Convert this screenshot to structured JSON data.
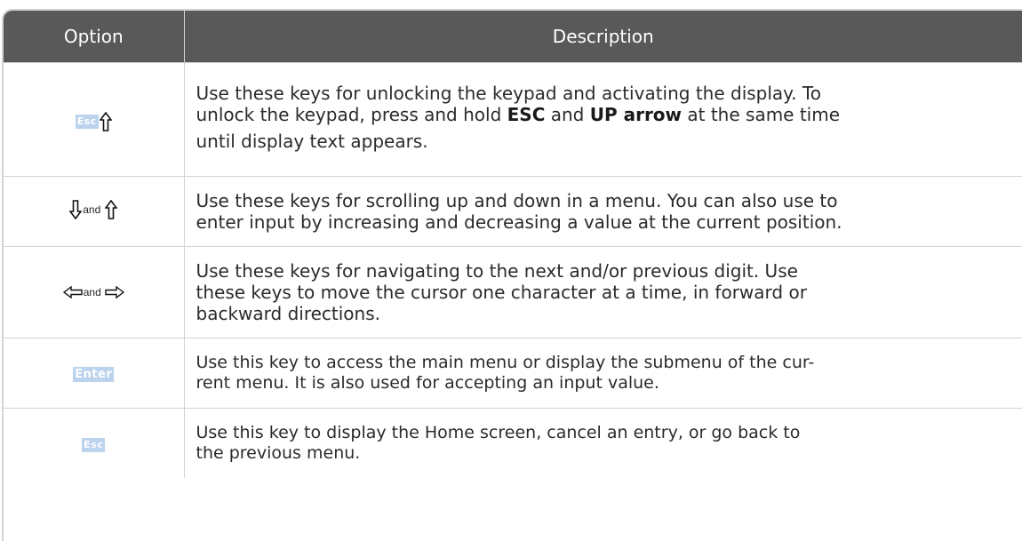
{
  "header": {
    "option": "Option",
    "description": "Description"
  },
  "rows": [
    {
      "option": {
        "key_label": "Esc",
        "icons": [
          "esc-key-icon",
          "up-arrow-icon"
        ]
      },
      "description": {
        "line1": "Use these keys for unlocking the keypad and activating the display. To",
        "line2_a": "unlock the keypad, press and hold ",
        "line2_b": "ESC",
        "line2_c": " and ",
        "line2_d": "UP arrow",
        "line2_e": " at the same time",
        "line3": "until display text appears."
      }
    },
    {
      "option": {
        "and_text": "and",
        "icons": [
          "down-arrow-icon",
          "up-arrow-icon"
        ]
      },
      "description": {
        "line1": "Use these keys for scrolling up and down in a menu. You can also use to",
        "line2": "enter input by increasing and decreasing a value at the current position."
      }
    },
    {
      "option": {
        "and_text": "and",
        "icons": [
          "left-arrow-icon",
          "right-arrow-icon"
        ]
      },
      "description": {
        "line1": "Use these keys for navigating to the next and/or previous digit. Use",
        "line2": "these keys to move the cursor one character at a time, in forward or",
        "line3": "backward directions."
      }
    },
    {
      "option": {
        "key_label": "Enter",
        "icons": [
          "enter-key-icon"
        ]
      },
      "description": {
        "line1": "Use this key to access the main menu or display the submenu of the cur-",
        "line2": "rent menu. It is also used for accepting an input value."
      }
    },
    {
      "option": {
        "key_label": "Esc",
        "icons": [
          "esc-key-icon"
        ]
      },
      "description": {
        "line1": "Use this key to display the Home screen, cancel an entry, or go back to",
        "line2": "the previous menu."
      }
    }
  ]
}
